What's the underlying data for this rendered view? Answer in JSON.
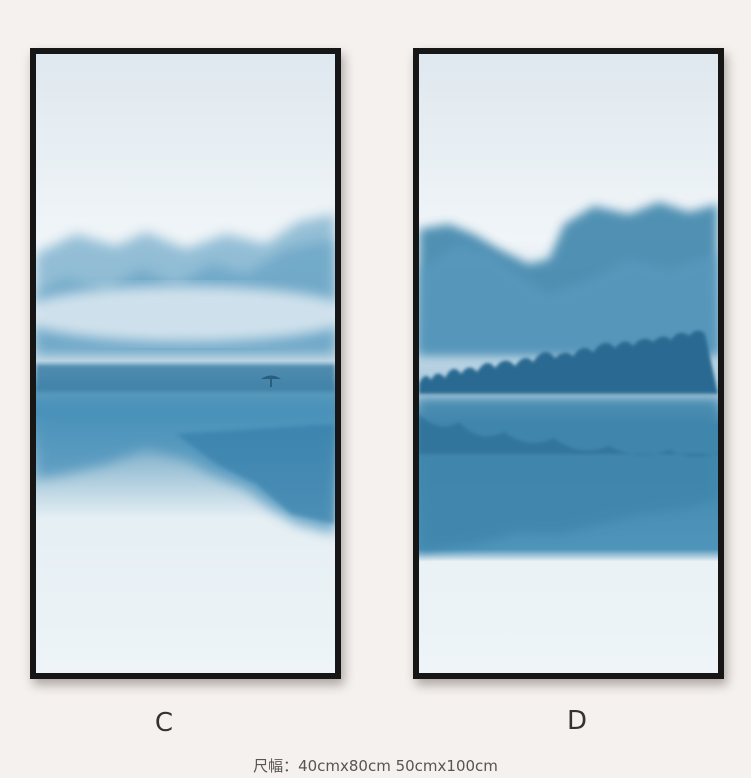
{
  "artworks": [
    {
      "label": "C",
      "image": "misty blue ink mountains reflected in a lake"
    },
    {
      "label": "D",
      "image": "blue ink mountains with tree line reflected in a lake"
    }
  ],
  "size_info": "尺幅：40cmx80cm  50cmx100cm",
  "colors": {
    "background": "#f5f1ee",
    "frame": "#161616",
    "ink_blue": "#3f86ac",
    "sky": "#e9f0f5"
  }
}
